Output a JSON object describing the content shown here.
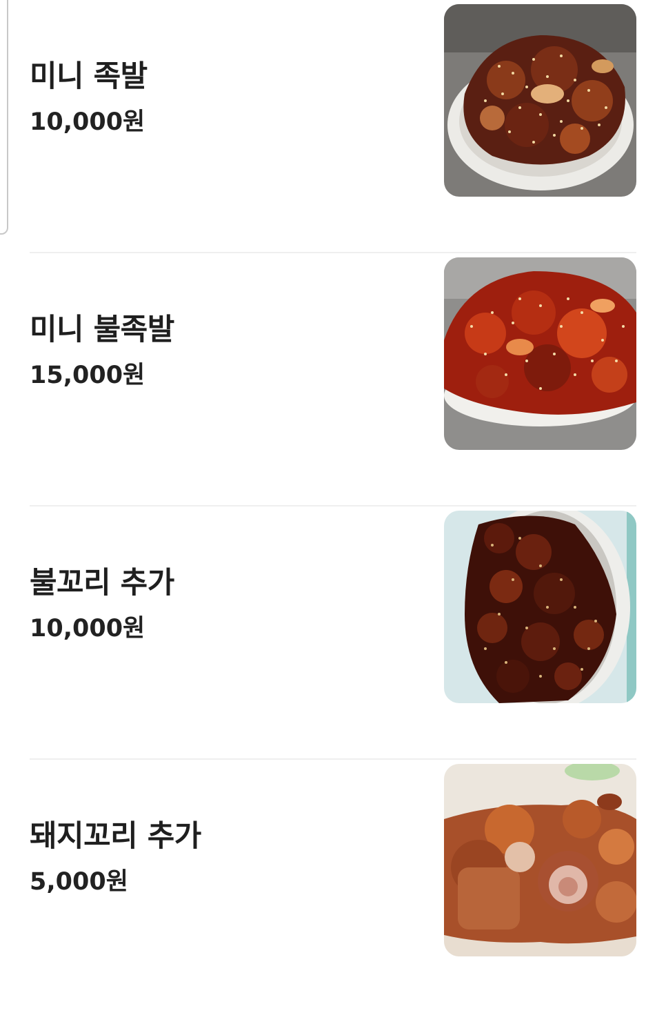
{
  "menu": {
    "items": [
      {
        "name": "미니 족발",
        "price": "10,000원",
        "photo": "mini-jokbal-photo"
      },
      {
        "name": "미니 불족발",
        "price": "15,000원",
        "photo": "mini-bul-jokbal-photo"
      },
      {
        "name": "불꼬리 추가",
        "price": "10,000원",
        "photo": "bul-kkori-photo"
      },
      {
        "name": "돼지꼬리 추가",
        "price": "5,000원",
        "photo": "pig-tail-photo"
      }
    ]
  },
  "colors": {
    "text": "#1f1f1f",
    "divider": "#efefef",
    "background": "#ffffff"
  }
}
